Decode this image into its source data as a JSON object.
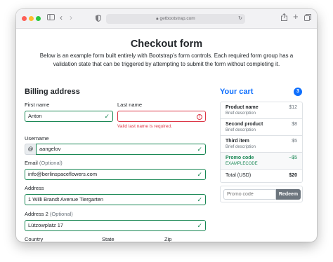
{
  "browser": {
    "url": "getbootstrap.com"
  },
  "page": {
    "title": "Checkout form",
    "lead": "Below is an example form built entirely with Bootstrap’s form controls. Each required form group has a validation state that can be triggered by attempting to submit the form without completing it."
  },
  "billing": {
    "heading": "Billing address",
    "first_name": {
      "label": "First name",
      "value": "Anton"
    },
    "last_name": {
      "label": "Last name",
      "value": "",
      "error": "Valid last name is required."
    },
    "username": {
      "label": "Username",
      "prefix": "@",
      "value": "aangelov"
    },
    "email": {
      "label": "Email",
      "optional": "(Optional)",
      "value": "info@berlinspaceflowers.com"
    },
    "address": {
      "label": "Address",
      "value": "1 Willi Brandt Avenue Tiergarten"
    },
    "address2": {
      "label": "Address 2",
      "optional": "(Optional)",
      "value": "Lützowplatz 17"
    },
    "country": {
      "label": "Country"
    },
    "state": {
      "label": "State"
    },
    "zip": {
      "label": "Zip"
    }
  },
  "cart": {
    "heading": "Your cart",
    "count": "3",
    "items": [
      {
        "name": "Product name",
        "desc": "Brief description",
        "price": "$12"
      },
      {
        "name": "Second product",
        "desc": "Brief description",
        "price": "$8"
      },
      {
        "name": "Third item",
        "desc": "Brief description",
        "price": "$5"
      }
    ],
    "promo": {
      "name": "Promo code",
      "code": "EXAMPLECODE",
      "amount": "−$5"
    },
    "total_label": "Total (USD)",
    "total_value": "$20",
    "promo_placeholder": "Promo code",
    "redeem_label": "Redeem"
  },
  "colors": {
    "valid": "#198754",
    "invalid": "#dc3545",
    "primary": "#0d6efd",
    "secondary": "#6c757d"
  },
  "icons": [
    "sidebar-icon",
    "back-icon",
    "forward-icon",
    "privacy-shield-icon",
    "lock-icon",
    "reload-icon",
    "share-icon",
    "new-tab-icon",
    "tabs-overview-icon",
    "checkmark-icon",
    "alert-circle-icon"
  ]
}
